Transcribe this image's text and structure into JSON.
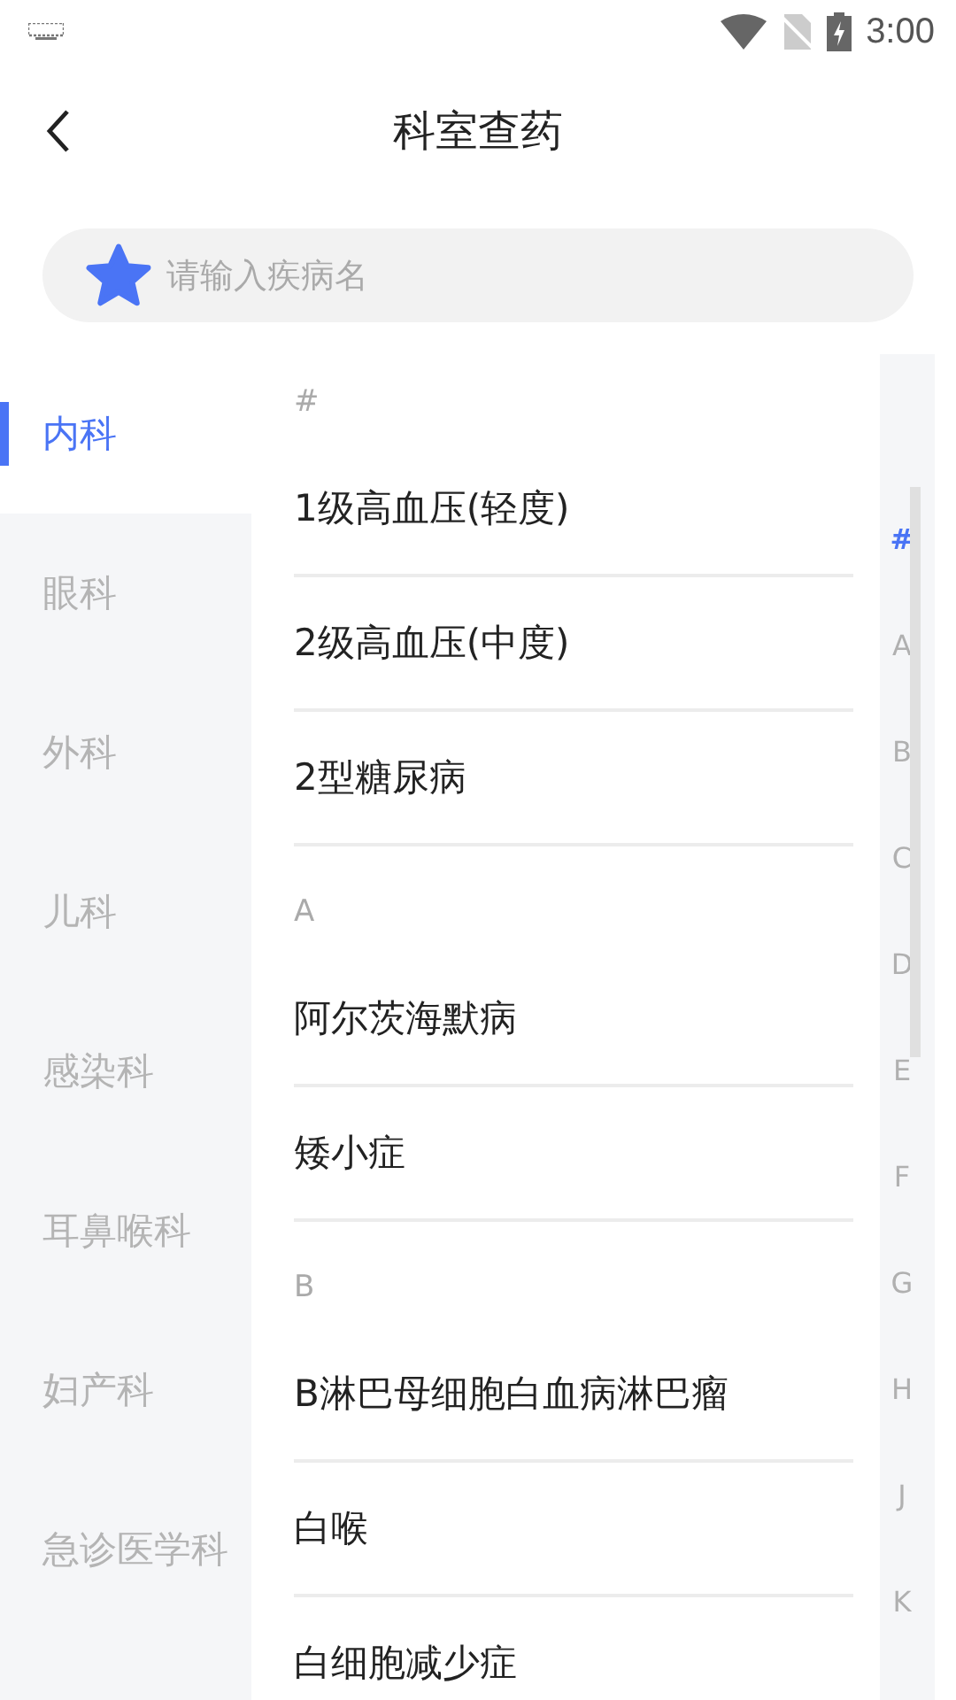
{
  "status_bar": {
    "time": "3:00"
  },
  "header": {
    "title": "科室查药"
  },
  "search": {
    "placeholder": "请输入疾病名"
  },
  "departments": [
    {
      "label": "内科",
      "selected": true
    },
    {
      "label": "眼科",
      "selected": false
    },
    {
      "label": "外科",
      "selected": false
    },
    {
      "label": "儿科",
      "selected": false
    },
    {
      "label": "感染科",
      "selected": false
    },
    {
      "label": "耳鼻喉科",
      "selected": false
    },
    {
      "label": "妇产科",
      "selected": false
    },
    {
      "label": "急诊医学科",
      "selected": false
    }
  ],
  "sections": [
    {
      "header": "#",
      "items": [
        "1级高血压(轻度)",
        "2级高血压(中度)",
        "2型糖尿病"
      ]
    },
    {
      "header": "A",
      "items": [
        "阿尔茨海默病",
        "矮小症"
      ]
    },
    {
      "header": "B",
      "items": [
        "B淋巴母细胞白血病淋巴瘤",
        "白喉",
        "白细胞减少症"
      ]
    }
  ],
  "index": [
    {
      "label": "#",
      "selected": true
    },
    {
      "label": "A",
      "selected": false
    },
    {
      "label": "B",
      "selected": false
    },
    {
      "label": "C",
      "selected": false
    },
    {
      "label": "D",
      "selected": false
    },
    {
      "label": "E",
      "selected": false
    },
    {
      "label": "F",
      "selected": false
    },
    {
      "label": "G",
      "selected": false
    },
    {
      "label": "H",
      "selected": false
    },
    {
      "label": "J",
      "selected": false
    },
    {
      "label": "K",
      "selected": false
    }
  ]
}
